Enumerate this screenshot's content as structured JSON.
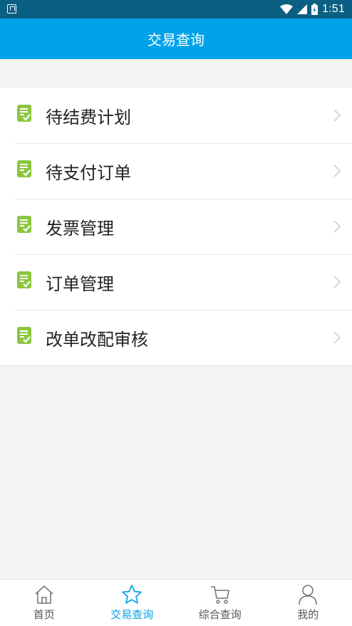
{
  "status_bar": {
    "time": "1:51",
    "icons": [
      "notification-icon",
      "wifi-icon",
      "signal-icon",
      "battery-icon"
    ]
  },
  "header": {
    "title": "交易查询"
  },
  "menu": {
    "items": [
      {
        "label": "待结费计划",
        "icon": "document-check-icon"
      },
      {
        "label": "待支付订单",
        "icon": "document-check-icon"
      },
      {
        "label": "发票管理",
        "icon": "document-check-icon"
      },
      {
        "label": "订单管理",
        "icon": "document-check-icon"
      },
      {
        "label": "改单改配审核",
        "icon": "document-check-icon"
      }
    ]
  },
  "tabbar": {
    "tabs": [
      {
        "label": "首页",
        "icon": "home-icon",
        "active": false
      },
      {
        "label": "交易查询",
        "icon": "star-icon",
        "active": true
      },
      {
        "label": "综合查询",
        "icon": "cart-icon",
        "active": false
      },
      {
        "label": "我的",
        "icon": "person-icon",
        "active": false
      }
    ]
  },
  "colors": {
    "primary": "#00a2ea",
    "status_bar": "#0b5f83",
    "icon_green": "#8cc63f"
  }
}
